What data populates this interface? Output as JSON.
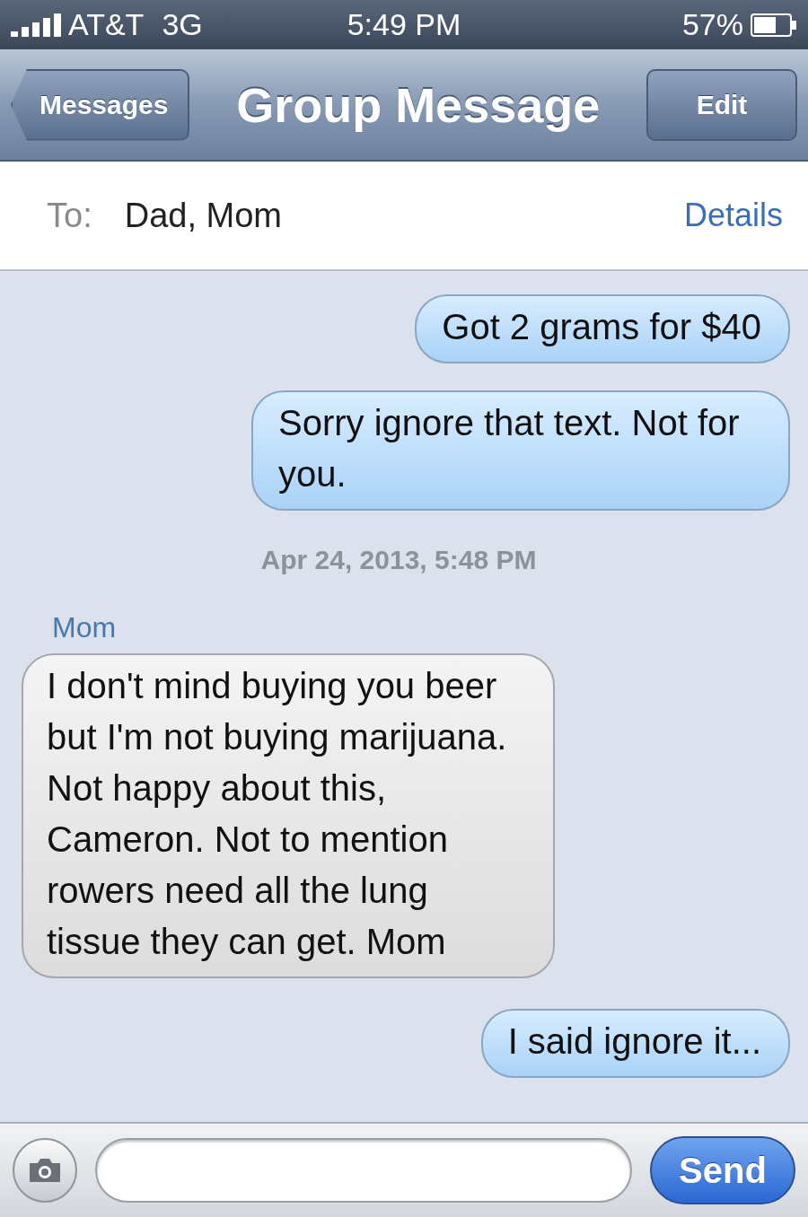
{
  "status_bar": {
    "carrier": "AT&T",
    "network": "3G",
    "time": "5:49 PM",
    "battery": "57%"
  },
  "nav_bar": {
    "back": "Messages",
    "title": "Group Message",
    "edit": "Edit"
  },
  "recipients": {
    "label": "To:",
    "names": "Dad, Mom",
    "details": "Details"
  },
  "messages": [
    {
      "kind": "sent",
      "text": "Got 2 grams for $40"
    },
    {
      "kind": "sent",
      "text": "Sorry ignore that text. Not for you."
    },
    {
      "kind": "timestamp",
      "text": "Apr 24, 2013, 5:48 PM"
    },
    {
      "kind": "received",
      "sender": "Mom",
      "text": "I don't mind buying you beer but I'm not buying marijuana. Not happy about this, Cameron. Not to mention rowers need all the lung tissue they can get. Mom"
    },
    {
      "kind": "sent",
      "text": "I said ignore it..."
    }
  ],
  "composer": {
    "send": "Send"
  }
}
